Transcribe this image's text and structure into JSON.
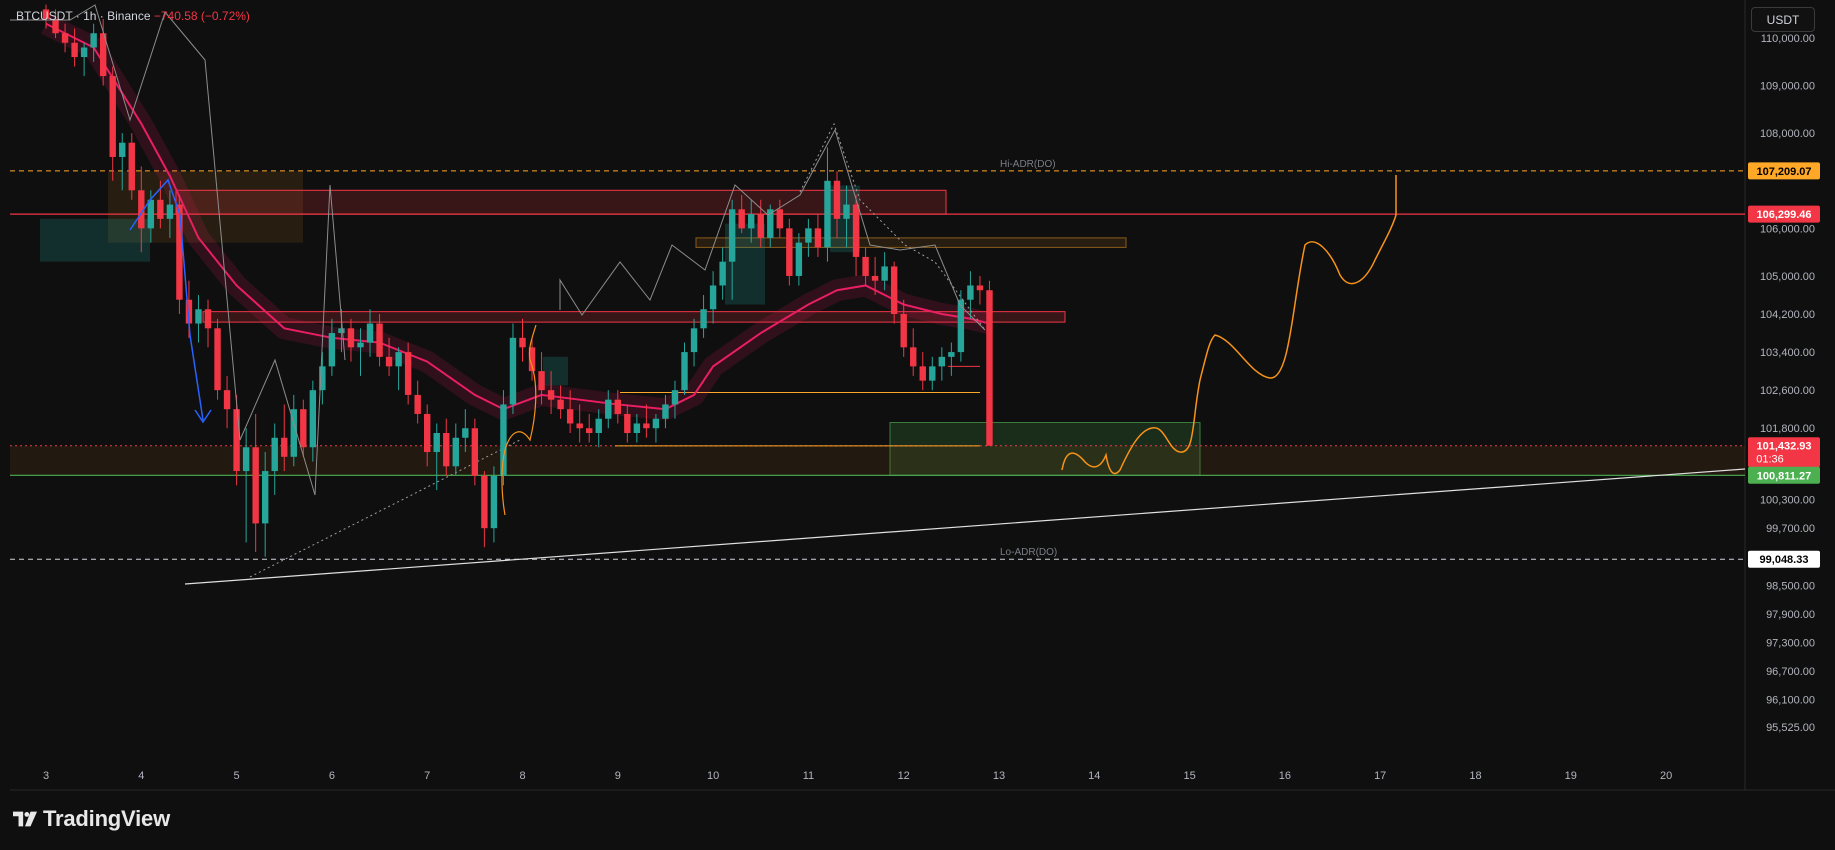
{
  "legend": {
    "symbol": "BTCUSDT · 1h · Binance",
    "change": "−740.58 (−0.72%)"
  },
  "toolbar": {
    "currency_label": "USDT"
  },
  "brand": {
    "name": "TradingView"
  },
  "colors": {
    "background": "#0f0f0f",
    "up": "#26a69a",
    "down": "#f23645",
    "ema": "#e91e63",
    "forecast": "#f7931a",
    "resistance": "#f23645",
    "support": "#4caf50",
    "adr": "#ffa726"
  },
  "chart_data": {
    "type": "candlestick",
    "symbol": "BTCUSDT",
    "interval": "1h",
    "exchange": "Binance",
    "y_ticks": [
      "110,000.00",
      "109,000.00",
      "108,000.00",
      "106,000.00",
      "105,000.00",
      "104,200.00",
      "103,400.00",
      "102,600.00",
      "101,800.00",
      "100,300.00",
      "99,700.00",
      "98,500.00",
      "97,900.00",
      "97,300.00",
      "96,700.00",
      "96,100.00",
      "95,525.00"
    ],
    "x_ticks": [
      "3",
      "4",
      "5",
      "6",
      "7",
      "8",
      "9",
      "10",
      "11",
      "12",
      "13",
      "14",
      "15",
      "16",
      "17",
      "18",
      "19",
      "20"
    ],
    "ylim": [
      95525,
      110500
    ],
    "price_tags": [
      {
        "label": "107,209.07",
        "value": 107209.07,
        "color": "#ffa726",
        "text_color": "#000000"
      },
      {
        "label": "106,299.46",
        "value": 106299.46,
        "color": "#f23645",
        "text_color": "#ffffff"
      },
      {
        "label": "101,432.93",
        "value": 101432.93,
        "color": "#f23645",
        "text_color": "#ffffff",
        "sub": "01:36"
      },
      {
        "label": "100,811.27",
        "value": 100811.27,
        "color": "#4caf50",
        "text_color": "#ffffff"
      },
      {
        "label": "99,048.33",
        "value": 99048.33,
        "color": "#ffffff",
        "text_color": "#000000"
      }
    ],
    "annotations": {
      "hi_adr": "Hi-ADR(DO)",
      "lo_adr": "Lo-ADR(DO)"
    },
    "candles": [
      [
        3.0,
        110600,
        110700,
        110200,
        110400
      ],
      [
        3.1,
        110400,
        110600,
        110000,
        110100
      ],
      [
        3.2,
        110100,
        110300,
        109700,
        109900
      ],
      [
        3.3,
        109900,
        110200,
        109400,
        109600
      ],
      [
        3.4,
        109600,
        109900,
        109200,
        109800
      ],
      [
        3.5,
        109800,
        110300,
        109500,
        110100
      ],
      [
        3.6,
        110100,
        110400,
        109000,
        109200
      ],
      [
        3.7,
        109200,
        109400,
        107000,
        107500
      ],
      [
        3.8,
        107500,
        108000,
        106800,
        107800
      ],
      [
        3.9,
        107800,
        108000,
        106600,
        106800
      ],
      [
        4.0,
        106800,
        107300,
        105500,
        106000
      ],
      [
        4.1,
        106000,
        106800,
        105700,
        106600
      ],
      [
        4.2,
        106600,
        107000,
        106000,
        106200
      ],
      [
        4.3,
        106200,
        106800,
        105800,
        106500
      ],
      [
        4.4,
        106500,
        106700,
        104200,
        104500
      ],
      [
        4.5,
        104500,
        104900,
        103700,
        104000
      ],
      [
        4.6,
        104000,
        104600,
        103600,
        104300
      ],
      [
        4.7,
        104300,
        104500,
        103500,
        103900
      ],
      [
        4.8,
        103900,
        104100,
        102400,
        102600
      ],
      [
        4.9,
        102600,
        102900,
        101800,
        102200
      ],
      [
        5.0,
        102200,
        102500,
        100600,
        100900
      ],
      [
        5.1,
        100900,
        101800,
        99400,
        101400
      ],
      [
        5.2,
        101400,
        102100,
        99200,
        99800
      ],
      [
        5.3,
        99800,
        101300,
        99100,
        100900
      ],
      [
        5.4,
        100900,
        101900,
        100400,
        101600
      ],
      [
        5.5,
        101600,
        102300,
        100900,
        101200
      ],
      [
        5.6,
        101200,
        102500,
        101000,
        102200
      ],
      [
        5.7,
        102200,
        102400,
        101200,
        101400
      ],
      [
        5.8,
        101400,
        102800,
        101100,
        102600
      ],
      [
        5.9,
        102600,
        103400,
        102300,
        103100
      ],
      [
        6.0,
        103100,
        104100,
        102900,
        103800
      ],
      [
        6.1,
        103800,
        104300,
        103400,
        103900
      ],
      [
        6.2,
        103900,
        104100,
        103200,
        103500
      ],
      [
        6.3,
        103500,
        103900,
        102900,
        103600
      ],
      [
        6.4,
        103600,
        104300,
        103300,
        104000
      ],
      [
        6.5,
        104000,
        104200,
        103100,
        103300
      ],
      [
        6.6,
        103300,
        103700,
        102900,
        103100
      ],
      [
        6.7,
        103100,
        103500,
        102600,
        103400
      ],
      [
        6.8,
        103400,
        103600,
        102300,
        102500
      ],
      [
        6.9,
        102500,
        102800,
        101900,
        102100
      ],
      [
        7.0,
        102100,
        102300,
        101000,
        101300
      ],
      [
        7.1,
        101300,
        101900,
        100500,
        101700
      ],
      [
        7.2,
        101700,
        102000,
        100800,
        101000
      ],
      [
        7.3,
        101000,
        101900,
        100800,
        101600
      ],
      [
        7.4,
        101600,
        102200,
        101300,
        101800
      ],
      [
        7.5,
        101800,
        102000,
        100600,
        100800
      ],
      [
        7.6,
        100800,
        100900,
        99300,
        99700
      ],
      [
        7.7,
        99700,
        101000,
        99400,
        100800
      ],
      [
        7.8,
        100800,
        102600,
        100600,
        102300
      ],
      [
        7.9,
        102300,
        104000,
        102100,
        103700
      ],
      [
        8.0,
        103700,
        104100,
        103200,
        103500
      ],
      [
        8.1,
        103500,
        103700,
        102800,
        103000
      ],
      [
        8.2,
        103000,
        103400,
        102300,
        102600
      ],
      [
        8.3,
        102600,
        103000,
        102100,
        102400
      ],
      [
        8.4,
        102400,
        102700,
        102000,
        102200
      ],
      [
        8.5,
        102200,
        102600,
        101700,
        101900
      ],
      [
        8.6,
        101900,
        102300,
        101500,
        101800
      ],
      [
        8.7,
        101800,
        102100,
        101500,
        101700
      ],
      [
        8.8,
        101700,
        102200,
        101400,
        102000
      ],
      [
        8.9,
        102000,
        102600,
        101800,
        102400
      ],
      [
        9.0,
        102400,
        102600,
        101900,
        102100
      ],
      [
        9.1,
        102100,
        102300,
        101500,
        101700
      ],
      [
        9.2,
        101700,
        102100,
        101500,
        101900
      ],
      [
        9.3,
        101900,
        102300,
        101600,
        101800
      ],
      [
        9.4,
        101800,
        102100,
        101500,
        102000
      ],
      [
        9.5,
        102000,
        102500,
        101800,
        102300
      ],
      [
        9.6,
        102300,
        102800,
        102000,
        102600
      ],
      [
        9.7,
        102600,
        103600,
        102500,
        103400
      ],
      [
        9.8,
        103400,
        104100,
        103100,
        103900
      ],
      [
        9.9,
        103900,
        104600,
        103700,
        104300
      ],
      [
        10.0,
        104300,
        105100,
        104000,
        104800
      ],
      [
        10.1,
        104800,
        105600,
        104500,
        105300
      ],
      [
        10.2,
        105300,
        106600,
        104500,
        106400
      ],
      [
        10.3,
        106400,
        106700,
        105900,
        106000
      ],
      [
        10.4,
        106000,
        106600,
        105700,
        106300
      ],
      [
        10.5,
        106300,
        106600,
        105600,
        105800
      ],
      [
        10.6,
        105800,
        106500,
        105600,
        106400
      ],
      [
        10.7,
        106400,
        106600,
        105800,
        106000
      ],
      [
        10.8,
        106000,
        106200,
        104800,
        105000
      ],
      [
        10.9,
        105000,
        105900,
        104800,
        105700
      ],
      [
        11.0,
        105700,
        106200,
        105400,
        106000
      ],
      [
        11.1,
        106000,
        106300,
        105400,
        105600
      ],
      [
        11.2,
        105600,
        107700,
        105300,
        107000
      ],
      [
        11.3,
        107000,
        107200,
        105800,
        106200
      ],
      [
        11.4,
        106200,
        106900,
        105600,
        106500
      ],
      [
        11.5,
        106500,
        106700,
        105000,
        105400
      ],
      [
        11.6,
        105400,
        105600,
        104800,
        105000
      ],
      [
        11.7,
        105000,
        105400,
        104600,
        104900
      ],
      [
        11.8,
        104900,
        105500,
        104700,
        105200
      ],
      [
        11.9,
        105200,
        105300,
        104000,
        104200
      ],
      [
        12.0,
        104200,
        104500,
        103300,
        103500
      ],
      [
        12.1,
        103500,
        103900,
        102900,
        103100
      ],
      [
        12.2,
        103100,
        103400,
        102600,
        102800
      ],
      [
        12.3,
        102800,
        103300,
        102600,
        103100
      ],
      [
        12.4,
        103100,
        103500,
        102800,
        103300
      ],
      [
        12.5,
        103300,
        103600,
        102900,
        103400
      ],
      [
        12.6,
        103400,
        104700,
        103200,
        104500
      ],
      [
        12.7,
        104500,
        105100,
        104100,
        104800
      ],
      [
        12.8,
        104800,
        105000,
        104400,
        104700
      ],
      [
        12.9,
        104700,
        104900,
        101500,
        101433
      ]
    ],
    "ema": [
      [
        3.0,
        110300
      ],
      [
        3.5,
        109800
      ],
      [
        4.0,
        108200
      ],
      [
        4.3,
        107100
      ],
      [
        4.6,
        105800
      ],
      [
        5.0,
        104800
      ],
      [
        5.5,
        103900
      ],
      [
        6.0,
        103700
      ],
      [
        6.5,
        103600
      ],
      [
        7.0,
        103200
      ],
      [
        7.5,
        102500
      ],
      [
        7.8,
        102200
      ],
      [
        8.2,
        102500
      ],
      [
        8.6,
        102400
      ],
      [
        9.0,
        102300
      ],
      [
        9.5,
        102200
      ],
      [
        9.8,
        102500
      ],
      [
        10.0,
        103100
      ],
      [
        10.5,
        103800
      ],
      [
        11.0,
        104400
      ],
      [
        11.3,
        104700
      ],
      [
        11.6,
        104800
      ],
      [
        12.0,
        104400
      ],
      [
        12.4,
        104200
      ],
      [
        12.7,
        104100
      ],
      [
        12.9,
        104000
      ]
    ]
  }
}
